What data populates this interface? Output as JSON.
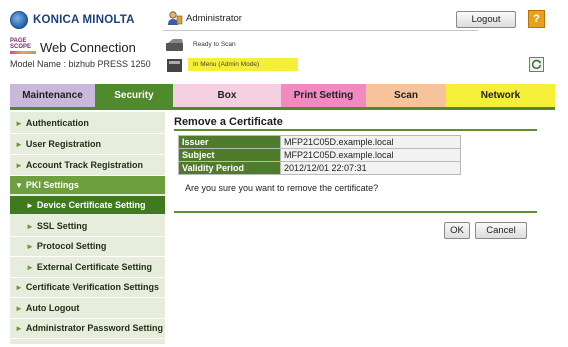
{
  "header": {
    "brand": "KONICA MINOLTA",
    "pagescope_mark": "PAGE SCOPE",
    "web_connection": "Web Connection",
    "model_label": "Model Name : bizhub PRESS 1250",
    "user": "Administrator",
    "logout_label": "Logout",
    "help_label": "?",
    "status_ready": "Ready to Scan",
    "status_mode": "In Menu (Admin Mode)",
    "status_mode_color": "#f5ef3a",
    "refresh_icon": "refresh-icon"
  },
  "tabs": [
    {
      "label": "Maintenance",
      "color": "#c9b8d9"
    },
    {
      "label": "Security",
      "color": "#4f8a2c",
      "active": true
    },
    {
      "label": "Box",
      "color": "#f3cfe0"
    },
    {
      "label": "Print Setting",
      "color": "#f08ac0"
    },
    {
      "label": "Scan",
      "color": "#f6c39a"
    },
    {
      "label": "Network",
      "color": "#f5ef3a"
    }
  ],
  "sidebar": {
    "items": [
      {
        "label": "Authentication"
      },
      {
        "label": "User Registration"
      },
      {
        "label": "Account Track Registration"
      },
      {
        "label": "PKI Settings",
        "expanded": true
      },
      {
        "label": "Device Certificate Setting",
        "active": true
      },
      {
        "label": "SSL Setting"
      },
      {
        "label": "Protocol Setting"
      },
      {
        "label": "External Certificate Setting"
      },
      {
        "label": "Certificate Verification Settings"
      },
      {
        "label": "Auto Logout"
      },
      {
        "label": "Administrator Password Setting"
      }
    ]
  },
  "main": {
    "title": "Remove a Certificate",
    "rows": [
      {
        "label": "Issuer",
        "value": "MFP21C05D.example.local"
      },
      {
        "label": "Subject",
        "value": "MFP21C05D.example.local"
      },
      {
        "label": "Validity Period",
        "value": "2012/12/01 22:07:31"
      }
    ],
    "confirm_text": "Are you sure you want to remove the certificate?",
    "ok_label": "OK",
    "cancel_label": "Cancel"
  },
  "colors": {
    "accent_green": "#4f8a2c",
    "sidebar_bg": "#e6eddd",
    "active_item": "#3f7a1f"
  }
}
